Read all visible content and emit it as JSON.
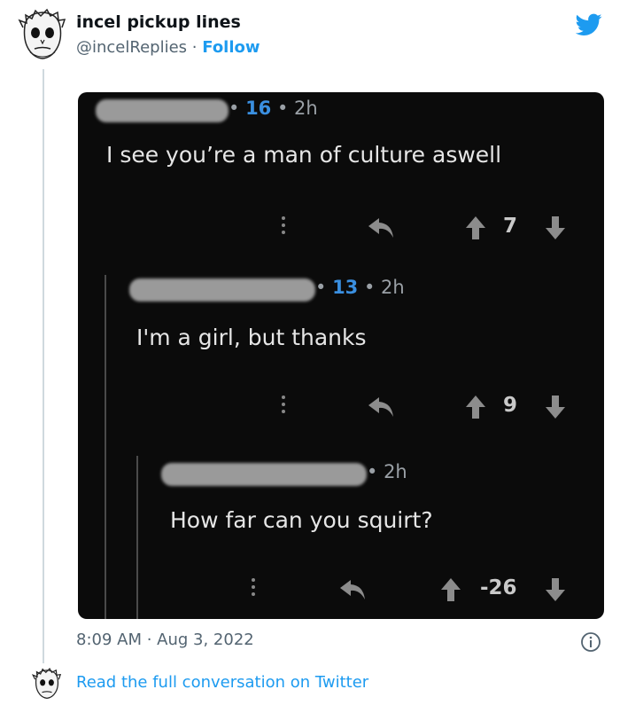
{
  "tweet": {
    "display_name": "incel pickup lines",
    "handle": "@incelReplies",
    "separator": "·",
    "follow_label": "Follow",
    "timestamp": "8:09 AM · Aug 3, 2022",
    "read_more_label": "Read the full conversation on Twitter"
  },
  "screenshot": {
    "comments": [
      {
        "score": "16",
        "age": "2h",
        "text": "I see you’re a man of culture aswell",
        "votes": "7"
      },
      {
        "score": "13",
        "age": "2h",
        "text": "I'm a girl, but thanks",
        "votes": "9"
      },
      {
        "score": "",
        "age": "2h",
        "text": "How far can you squirt?",
        "votes": "-26"
      }
    ]
  },
  "colors": {
    "accent": "#1d9bf0",
    "score_blue": "#3a8fe0",
    "screenshot_bg": "#0b0b0b"
  },
  "icons": [
    "twitter-bird-icon",
    "info-icon",
    "reply-arrow-icon",
    "upvote-arrow-icon",
    "downvote-arrow-icon",
    "more-dots-icon"
  ]
}
